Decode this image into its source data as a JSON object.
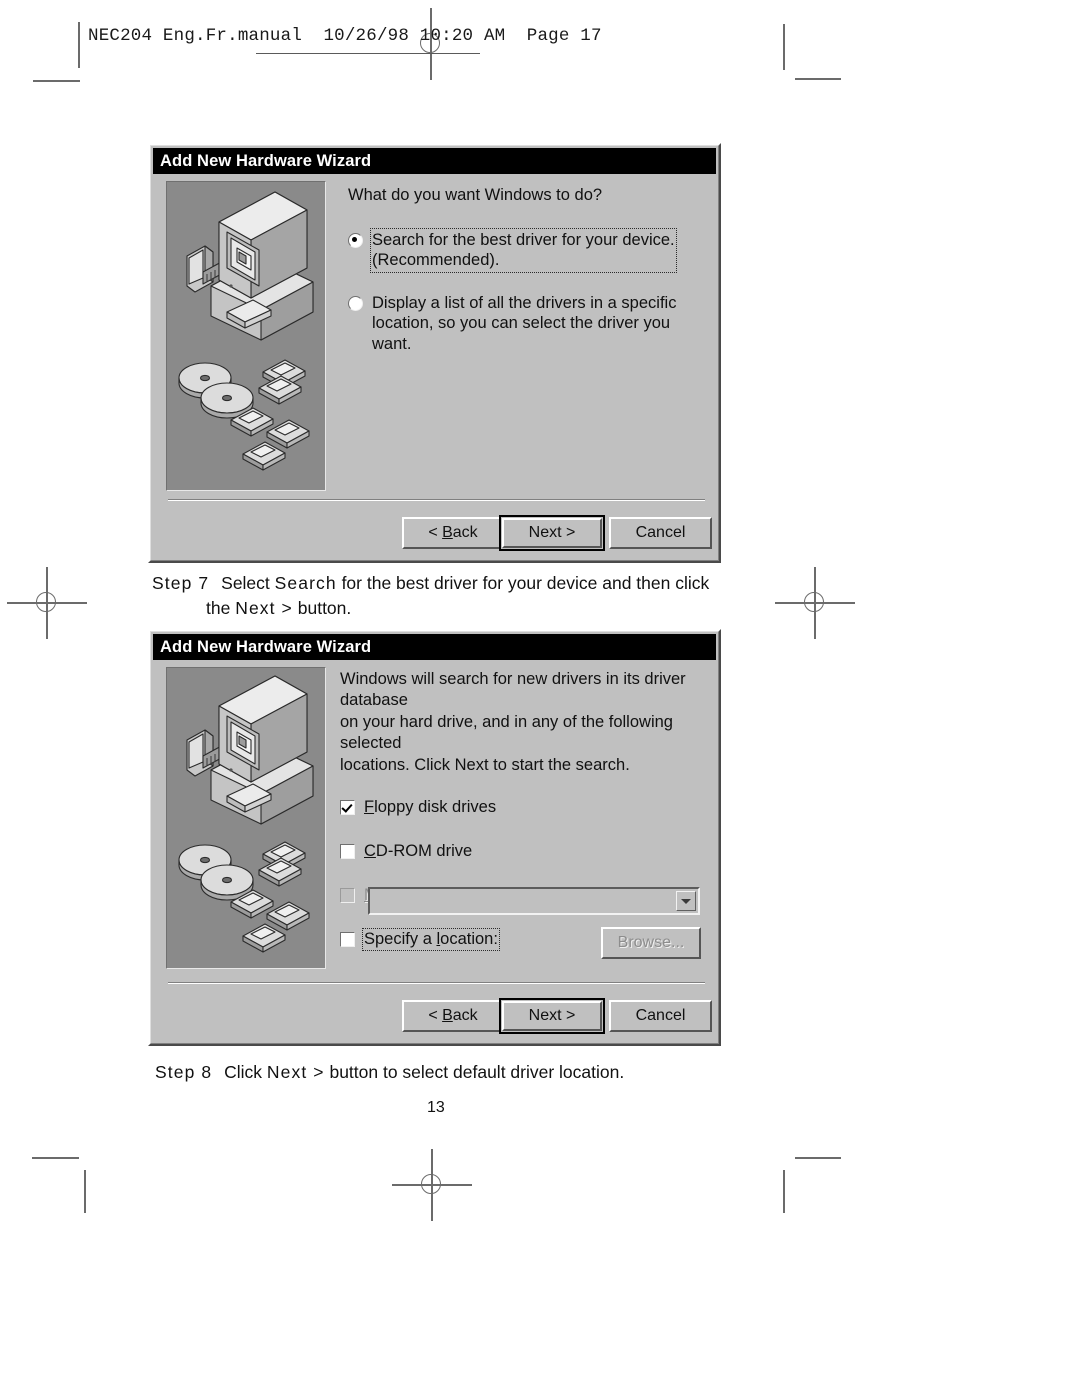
{
  "page": {
    "header": "NEC204 Eng.Fr.manual  10/26/98 10:20 AM  Page 17",
    "number": "13"
  },
  "dialog1": {
    "title": "Add New Hardware Wizard",
    "prompt": "What do you want Windows to do?",
    "options": [
      {
        "label": "Search for the best driver for your device.\n(Recommended).",
        "selected": true,
        "focused": true
      },
      {
        "label": "Display a list of all the drivers in a specific\nlocation, so you can select the driver you want.",
        "selected": false,
        "focused": false
      }
    ],
    "buttons": {
      "back": "< Back",
      "next": "Next >",
      "cancel": "Cancel"
    }
  },
  "step7": {
    "label": "Step 7",
    "text": "Select Search for the best driver for your device and then click\nthe Next > button."
  },
  "dialog2": {
    "title": "Add New Hardware Wizard",
    "prompt": "Windows will search for new drivers in its driver database\non your hard drive, and in any of the following selected\nlocations. Click Next to start the search.",
    "checkboxes": [
      {
        "label": "Floppy disk drives",
        "checked": true,
        "disabled": false,
        "focused": false
      },
      {
        "label": "CD-ROM drive",
        "checked": false,
        "disabled": false,
        "focused": false
      },
      {
        "label": "Microsoft Windows Update",
        "checked": false,
        "disabled": true,
        "focused": false
      },
      {
        "label": "Specify a location:",
        "checked": false,
        "disabled": false,
        "focused": true
      }
    ],
    "location_value": "",
    "browse_label": "Browse...",
    "buttons": {
      "back": "< Back",
      "next": "Next >",
      "cancel": "Cancel"
    }
  },
  "step8": {
    "label": "Step 8",
    "text": "Click Next > button to select default driver location."
  },
  "colors": {
    "dialog_face": "#c0c0c0",
    "titlebar": "#000000",
    "illustration_bg": "#8a8a8a"
  }
}
